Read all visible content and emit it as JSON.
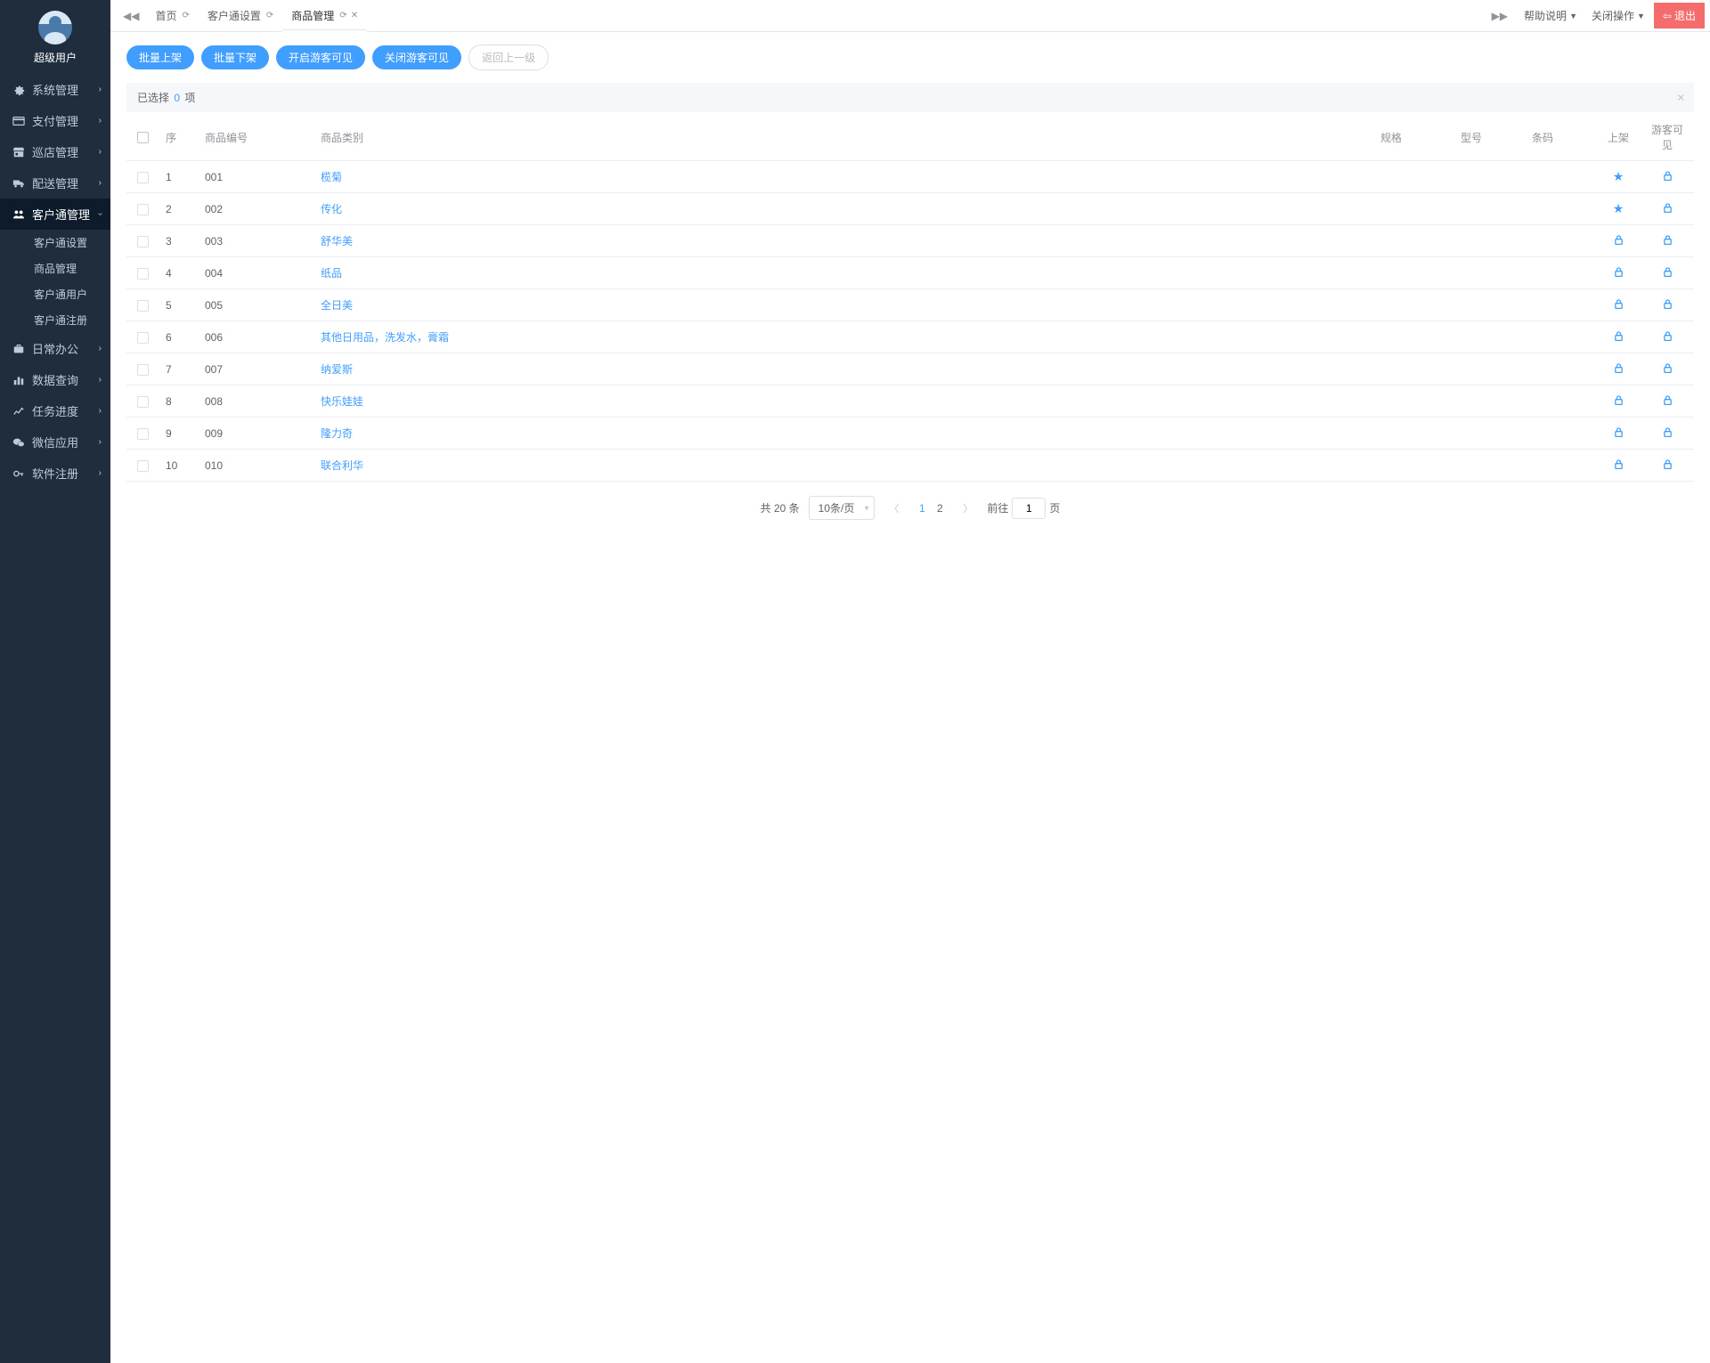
{
  "user": {
    "name": "超级用户"
  },
  "sidebar": {
    "items": [
      {
        "label": "系统管理",
        "icon": "cogs"
      },
      {
        "label": "支付管理",
        "icon": "card"
      },
      {
        "label": "巡店管理",
        "icon": "store"
      },
      {
        "label": "配送管理",
        "icon": "truck"
      },
      {
        "label": "客户通管理",
        "icon": "users",
        "active": true,
        "sub": [
          {
            "label": "客户通设置"
          },
          {
            "label": "商品管理"
          },
          {
            "label": "客户通用户"
          },
          {
            "label": "客户通注册"
          }
        ]
      },
      {
        "label": "日常办公",
        "icon": "briefcase"
      },
      {
        "label": "数据查询",
        "icon": "barchart"
      },
      {
        "label": "任务进度",
        "icon": "linechart"
      },
      {
        "label": "微信应用",
        "icon": "wechat"
      },
      {
        "label": "软件注册",
        "icon": "key"
      }
    ]
  },
  "tabs": {
    "items": [
      {
        "label": "首页"
      },
      {
        "label": "客户通设置"
      },
      {
        "label": "商品管理",
        "active": true
      }
    ],
    "right_help": "帮助说明",
    "right_close_ops": "关闭操作",
    "logout": "退出"
  },
  "actions": {
    "batch_on": "批量上架",
    "batch_off": "批量下架",
    "guest_on": "开启游客可见",
    "guest_off": "关闭游客可见",
    "back_up": "返回上一级"
  },
  "selection": {
    "prefix": "已选择",
    "count": "0",
    "suffix": "项"
  },
  "table": {
    "headers": {
      "seq": "序",
      "code": "商品编号",
      "cat": "商品类别",
      "spec": "规格",
      "model": "型号",
      "barcode": "条码",
      "shelf": "上架",
      "guest": "游客可见"
    },
    "rows": [
      {
        "seq": "1",
        "code": "001",
        "cat": "榄菊",
        "shelf": "star",
        "guest": "lock"
      },
      {
        "seq": "2",
        "code": "002",
        "cat": "传化",
        "shelf": "star",
        "guest": "lock"
      },
      {
        "seq": "3",
        "code": "003",
        "cat": "舒华美",
        "shelf": "lock",
        "guest": "lock"
      },
      {
        "seq": "4",
        "code": "004",
        "cat": "纸品",
        "shelf": "lock",
        "guest": "lock"
      },
      {
        "seq": "5",
        "code": "005",
        "cat": "全日美",
        "shelf": "lock",
        "guest": "lock"
      },
      {
        "seq": "6",
        "code": "006",
        "cat": "其他日用品，洗发水，膏霜",
        "shelf": "lock",
        "guest": "lock"
      },
      {
        "seq": "7",
        "code": "007",
        "cat": "纳爱斯",
        "shelf": "lock",
        "guest": "lock"
      },
      {
        "seq": "8",
        "code": "008",
        "cat": "快乐娃娃",
        "shelf": "lock",
        "guest": "lock"
      },
      {
        "seq": "9",
        "code": "009",
        "cat": "隆力奇",
        "shelf": "lock",
        "guest": "lock"
      },
      {
        "seq": "10",
        "code": "010",
        "cat": "联合利华",
        "shelf": "lock",
        "guest": "lock"
      }
    ]
  },
  "pagination": {
    "total_text": "共 20 条",
    "page_size": "10条/页",
    "pages": [
      "1",
      "2"
    ],
    "current": "1",
    "goto_prefix": "前往",
    "goto_value": "1",
    "goto_suffix": "页"
  }
}
